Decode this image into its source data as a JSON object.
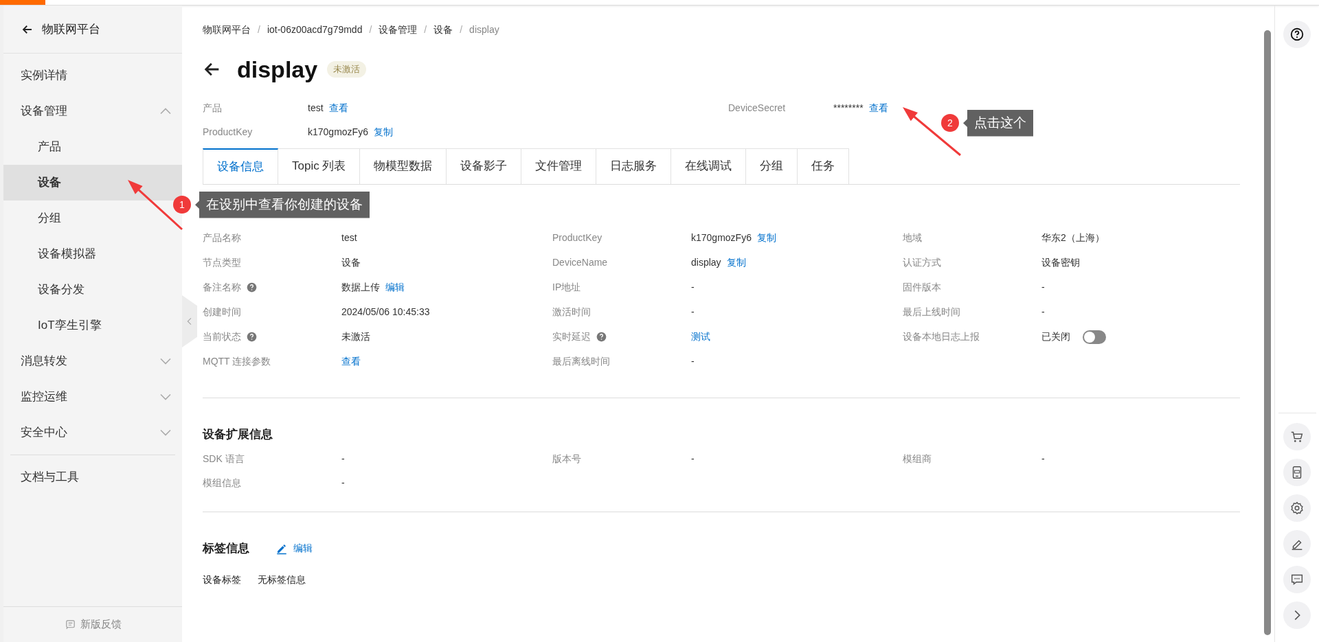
{
  "sidebar": {
    "back_label": "物联网平台",
    "items": [
      {
        "label": "实例详情",
        "kind": "link",
        "selected": false
      },
      {
        "label": "设备管理",
        "kind": "group",
        "expanded": true,
        "selected": false,
        "children": [
          {
            "label": "产品",
            "selected": false
          },
          {
            "label": "设备",
            "selected": true
          },
          {
            "label": "分组",
            "selected": false
          },
          {
            "label": "设备模拟器",
            "selected": false
          },
          {
            "label": "设备分发",
            "selected": false
          },
          {
            "label": "IoT孪生引擎",
            "selected": false
          }
        ]
      },
      {
        "label": "消息转发",
        "kind": "group",
        "expanded": false,
        "selected": false
      },
      {
        "label": "监控运维",
        "kind": "group",
        "expanded": false,
        "selected": false
      },
      {
        "label": "安全中心",
        "kind": "group",
        "expanded": false,
        "selected": false
      },
      {
        "label": "文档与工具",
        "kind": "link",
        "selected": false
      }
    ],
    "footer": "新版反馈"
  },
  "breadcrumb_separator": "/",
  "breadcrumb": [
    {
      "label": "物联网平台",
      "current": false
    },
    {
      "label": "iot-06z00acd7g79mdd",
      "current": false
    },
    {
      "label": "设备管理",
      "current": false
    },
    {
      "label": "设备",
      "current": false
    },
    {
      "label": "display",
      "current": true
    }
  ],
  "header": {
    "title": "display",
    "status": "未激活"
  },
  "summary": [
    {
      "label": "产品",
      "value": "test",
      "action": "查看"
    },
    {
      "label": "DeviceSecret",
      "value": "********",
      "action": "查看"
    },
    {
      "label": "ProductKey",
      "value": "k170gmozFy6",
      "action": "复制"
    }
  ],
  "tabs": [
    {
      "label": "设备信息",
      "selected": true
    },
    {
      "label": "Topic 列表",
      "selected": false
    },
    {
      "label": "物模型数据",
      "selected": false
    },
    {
      "label": "设备影子",
      "selected": false
    },
    {
      "label": "文件管理",
      "selected": false
    },
    {
      "label": "日志服务",
      "selected": false
    },
    {
      "label": "在线调试",
      "selected": false
    },
    {
      "label": "分组",
      "selected": false
    },
    {
      "label": "任务",
      "selected": false
    }
  ],
  "device_info": [
    {
      "label": "产品名称",
      "kind": "text",
      "value": "test"
    },
    {
      "label": "ProductKey",
      "kind": "text",
      "value": "k170gmozFy6",
      "action": "复制"
    },
    {
      "label": "地域",
      "kind": "text",
      "value": "华东2（上海）"
    },
    {
      "label": "节点类型",
      "kind": "text",
      "value": "设备"
    },
    {
      "label": "DeviceName",
      "kind": "text",
      "value": "display",
      "action": "复制"
    },
    {
      "label": "认证方式",
      "kind": "text",
      "value": "设备密钥"
    },
    {
      "label": "备注名称",
      "help": true,
      "kind": "text",
      "value": "数据上传",
      "action": "编辑"
    },
    {
      "label": "IP地址",
      "kind": "text",
      "value": "-"
    },
    {
      "label": "固件版本",
      "kind": "text",
      "value": "-"
    },
    {
      "label": "创建时间",
      "kind": "text",
      "value": "2024/05/06 10:45:33"
    },
    {
      "label": "激活时间",
      "kind": "text",
      "value": "-"
    },
    {
      "label": "最后上线时间",
      "kind": "text",
      "value": "-"
    },
    {
      "label": "当前状态",
      "help": true,
      "kind": "text",
      "value": "未激活"
    },
    {
      "label": "实时延迟",
      "help": true,
      "kind": "link",
      "value": "测试"
    },
    {
      "label": "设备本地日志上报",
      "kind": "toggle",
      "value": "已关闭",
      "on": false
    },
    {
      "label": "MQTT 连接参数",
      "kind": "link",
      "value": "查看"
    },
    {
      "label": "最后离线时间",
      "kind": "text",
      "value": "-"
    }
  ],
  "extension": {
    "title": "设备扩展信息",
    "fields": [
      {
        "label": "SDK 语言",
        "value": "-"
      },
      {
        "label": "版本号",
        "value": "-"
      },
      {
        "label": "模组商",
        "value": "-"
      },
      {
        "label": "模组信息",
        "value": "-"
      }
    ]
  },
  "tags": {
    "title": "标签信息",
    "edit": "编辑",
    "label": "设备标签",
    "value": "无标签信息"
  },
  "annotations": [
    {
      "number": "1",
      "text": "在设别中查看你创建的设备"
    },
    {
      "number": "2",
      "text": "点击这个"
    }
  ]
}
